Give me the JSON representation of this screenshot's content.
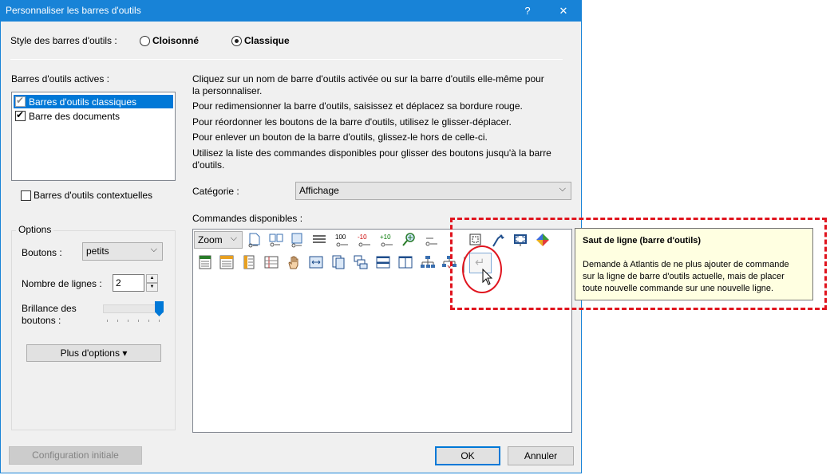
{
  "dialog": {
    "title": "Personnaliser les barres d'outils",
    "help_glyph": "?",
    "close_glyph": "✕"
  },
  "style": {
    "label": "Style des barres d'outils :",
    "option_cloisonne": "Cloisonné",
    "option_classique": "Classique",
    "selected": "Classique"
  },
  "active_toolbars": {
    "label": "Barres d'outils actives :",
    "items": [
      {
        "label": "Barres d'outils classiques",
        "checked": true,
        "selected": true
      },
      {
        "label": "Barre des documents",
        "checked": true,
        "selected": false
      }
    ]
  },
  "contextual": {
    "label": "Barres d'outils contextuelles",
    "checked": false
  },
  "options": {
    "title": "Options",
    "buttons_label": "Boutons :",
    "buttons_value": "petits",
    "lines_label": "Nombre de lignes :",
    "lines_value": "2",
    "brightness_label_1": "Brillance des",
    "brightness_label_2": "boutons :",
    "brightness_level": 1.0,
    "more_options": "Plus d'options ▾"
  },
  "instructions": {
    "line1a": "Cliquez sur un nom de barre d'outils activée ou sur la barre d'outils elle-même pour",
    "line1b": "la personnaliser.",
    "line2": "Pour redimensionner la barre d'outils, saisissez et déplacez sa bordure rouge.",
    "line3": "Pour réordonner les boutons de la barre d'outils, utilisez le glisser-déplacer.",
    "line4": "Pour enlever un bouton de la barre d'outils, glissez-le hors de celle-ci.",
    "line5a": "Utilisez la liste des commandes disponibles pour glisser des boutons jusqu'à la barre",
    "line5b": "d'outils."
  },
  "category": {
    "label": "Catégorie :",
    "value": "Affichage"
  },
  "commands": {
    "label": "Commandes disponibles :",
    "zoom_value": "Zoom",
    "row1_icons": [
      "page-icon",
      "two-pages-icon",
      "page-width-icon",
      "lines-icon",
      "zoom-100-icon",
      "zoom-minus-10-icon",
      "zoom-plus-10-icon",
      "magnifier-icon",
      "zoom-minus-icon",
      "split-view-icon",
      "screen-capture-icon",
      "desk-lamp-icon",
      "fullscreen-icon",
      "color-wheel-icon"
    ],
    "row1_labels": {
      "zoom100": "100",
      "minus10": "-10",
      "plus10": "+10"
    },
    "row2_icons": [
      "ruler-icon",
      "toolbar-icon",
      "vertical-ruler-icon",
      "table-grid-icon",
      "hand-icon",
      "fit-width-icon",
      "document-icon",
      "copy-windows-icon",
      "tile-horizontal-icon",
      "tile-vertical-icon",
      "network-icon",
      "network-split-icon"
    ],
    "line_break_glyph": "↵"
  },
  "tooltip": {
    "title": "Saut de ligne (barre d'outils)",
    "line1": "Demande à Atlantis de ne plus ajouter de commande",
    "line2": "sur la ligne de barre d'outils actuelle, mais de placer",
    "line3": "toute nouvelle commande sur une nouvelle ligne."
  },
  "footer": {
    "reset": "Configuration initiale",
    "ok": "OK",
    "cancel": "Annuler"
  },
  "colors": {
    "title_bar": "#1883d7",
    "selection": "#0078d7",
    "highlight_red": "#e0141e",
    "tooltip_bg": "#ffffe1"
  }
}
